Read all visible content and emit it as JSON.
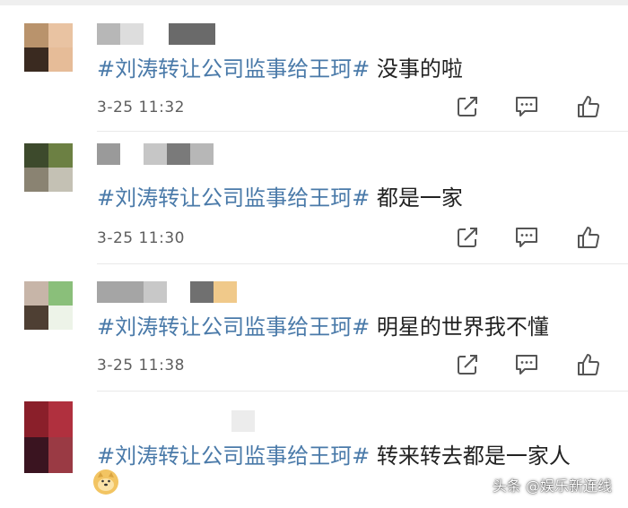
{
  "comments": [
    {
      "avatar_colors": [
        "#b9936c",
        "#e9c3a2",
        "#3a2a20",
        "#e6bc98"
      ],
      "name_block_colors": [
        "#b7b7b7",
        "#dddddd",
        "#6a6a6a"
      ],
      "hashtag": "#刘涛转让公司监事给王珂#",
      "text": " 没事的啦",
      "time": "3-25 11:32"
    },
    {
      "avatar_colors": [
        "#3d4a2c",
        "#6c8043",
        "#8a8372",
        "#c4c1b4"
      ],
      "name_block_colors": [
        "#9a9a9a",
        "#c6c6c6",
        "#7a7a7a",
        "#b7b7b7"
      ],
      "hashtag": "#刘涛转让公司监事给王珂#",
      "text": " 都是一家",
      "time": "3-25 11:30"
    },
    {
      "avatar_colors": [
        "#c7b5a8",
        "#8abf7a",
        "#4e3f33",
        "#edf3e8"
      ],
      "name_block_colors": [
        "#a5a5a5",
        "#c8c8c8",
        "#707070",
        "#f0c98a"
      ],
      "hashtag": "#刘涛转让公司监事给王珂#",
      "text": " 明星的世界我不懂",
      "time": "3-25 11:38"
    },
    {
      "avatar_colors": [
        "#8a1f2a",
        "#b0303e",
        "#3a1420",
        "#9a3a44"
      ],
      "name_block_colors": [
        "#ececec"
      ],
      "hashtag": "#刘涛转让公司监事给王珂#",
      "text": " 转来转去都是一家人",
      "time": ""
    }
  ],
  "actions": {
    "repost_icon": "share-icon",
    "comment_icon": "comment-icon",
    "like_icon": "thumbs-up-icon"
  },
  "emoji": "doge-emoji",
  "watermark": "头条 @娱乐新连线",
  "colors": {
    "hashtag": "#4a7aa9",
    "text": "#222222",
    "time": "#5e5e5e",
    "icon": "#555555"
  }
}
